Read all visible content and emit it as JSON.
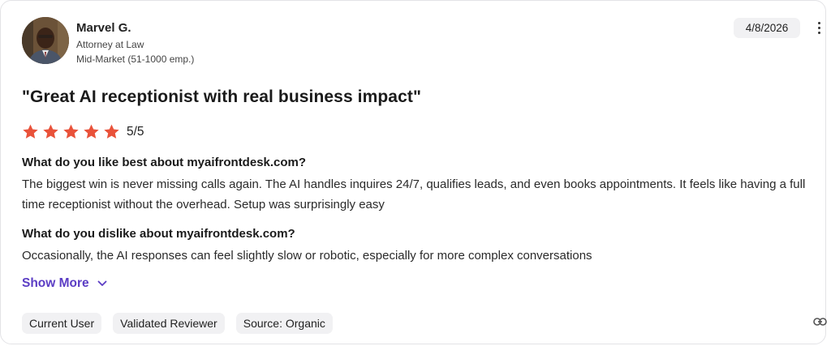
{
  "reviewer": {
    "name": "Marvel G.",
    "title": "Attorney at Law",
    "segment": "Mid-Market (51-1000 emp.)",
    "avatar_icon": "reviewer-photo"
  },
  "date": "4/8/2026",
  "menu_icon": "vertical-ellipsis-icon",
  "review": {
    "headline": "\"Great AI receptionist with real business impact\"",
    "stars_filled": 5,
    "stars_total": 5,
    "star_color": "#e9523a",
    "rating_text": "5/5",
    "sections": [
      {
        "question": "What do you like best about myaifrontdesk.com?",
        "answer": "The biggest win is never missing calls again. The AI handles inquires 24/7, qualifies leads, and even books appointments. It feels like having a full time receptionist without the overhead. Setup was surprisingly easy"
      },
      {
        "question": "What do you dislike about myaifrontdesk.com?",
        "answer": "Occasionally, the AI responses can feel slightly slow or robotic, especially for more complex conversations"
      }
    ]
  },
  "show_more_label": "Show More",
  "accent_color": "#5b3dc4",
  "tags": [
    "Current User",
    "Validated Reviewer",
    "Source: Organic"
  ],
  "link_icon": "link-icon"
}
